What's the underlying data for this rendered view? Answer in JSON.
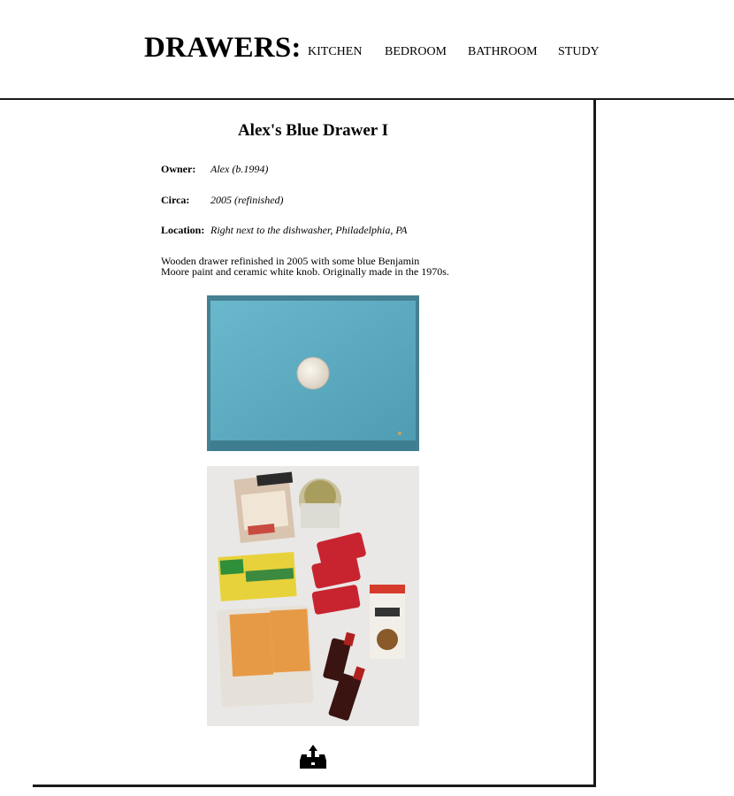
{
  "site": {
    "logo": "DRAWERS:"
  },
  "nav": [
    {
      "label": "KITCHEN"
    },
    {
      "label": "BEDROOM"
    },
    {
      "label": "BATHROOM"
    },
    {
      "label": "STUDY"
    }
  ],
  "drawer": {
    "title": "Alex's Blue Drawer I",
    "owner_label": "Owner:",
    "owner_value": "Alex (b.1994)",
    "circa_label": "Circa:",
    "circa_value": "2005 (refinished)",
    "location_label": "Location:",
    "location_value": "Right next to the dishwasher, Philadelphia, PA",
    "description_line1": "Wooden drawer refinished in 2005 with some blue Benjamin",
    "description_line2": "Moore paint and ceramic white knob. Originally made in the 1970s."
  },
  "footer": {
    "icon": "open-drawer-icon"
  },
  "colors": {
    "drawer_blue": "#5fb0c6",
    "knob": "#efe8dc",
    "rule": "#1a1a1a"
  }
}
